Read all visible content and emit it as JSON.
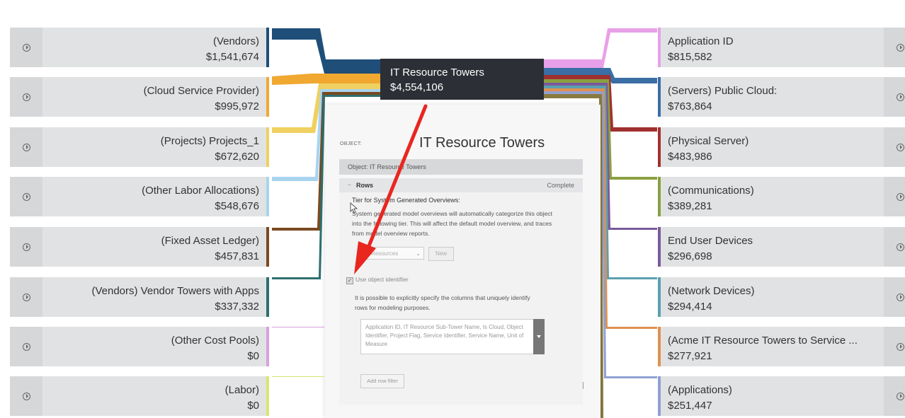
{
  "center": {
    "name": "IT Resource Towers",
    "value": "$4,554,106"
  },
  "left_nodes": [
    {
      "name": "(Vendors)",
      "value": "$1,541,674",
      "color": "#1f4e79"
    },
    {
      "name": "(Cloud Service Provider)",
      "value": "$995,972",
      "color": "#f0a830"
    },
    {
      "name": "(Projects) Projects_1",
      "value": "$672,620",
      "color": "#f0d060"
    },
    {
      "name": "(Other Labor Allocations)",
      "value": "$548,676",
      "color": "#a8d4f0"
    },
    {
      "name": "(Fixed Asset Ledger)",
      "value": "$457,831",
      "color": "#7a4a20"
    },
    {
      "name": "(Vendors) Vendor Towers with Apps",
      "value": "$337,332",
      "color": "#2e6f6f"
    },
    {
      "name": "(Other Cost Pools)",
      "value": "$0",
      "color": "#d8a0e0"
    },
    {
      "name": "(Labor)",
      "value": "$0",
      "color": "#d8e870"
    }
  ],
  "right_nodes": [
    {
      "name": "Application ID",
      "value": "$815,582",
      "color": "#e8a0e8"
    },
    {
      "name": "(Servers) Public Cloud:",
      "value": "$763,864",
      "color": "#3a6ea5"
    },
    {
      "name": "(Physical Server)",
      "value": "$483,986",
      "color": "#a03030"
    },
    {
      "name": "(Communications)",
      "value": "$389,281",
      "color": "#8aa040"
    },
    {
      "name": "End User Devices",
      "value": "$296,698",
      "color": "#7a5a9a"
    },
    {
      "name": "(Network Devices)",
      "value": "$294,414",
      "color": "#5aa0b0"
    },
    {
      "name": "(Acme IT Resource Towers to Service ...",
      "value": "$277,921",
      "color": "#e09050"
    },
    {
      "name": "(Applications)",
      "value": "$251,447",
      "color": "#90a0d0"
    }
  ],
  "panel": {
    "object_label": "OBJECT:",
    "title": "IT Resource Towers",
    "object_bar": "Object: IT Resource Towers",
    "rows_label": "Rows",
    "rows_status": "Complete",
    "tier_title": "Tier for System Generated Overviews:",
    "tier_desc": "System generated model overviews will automatically categorize this object into the following tier. This will affect the default model overview, and traces from model overview reports.",
    "tier_select": "Resources",
    "new_button": "New",
    "use_identifier": "Use object identifier",
    "use_identifier_desc": "It is possible to explicitly specify the columns that uniquely identify rows for modeling purposes.",
    "identifier_columns": "Application ID, IT Resource Sub-Tower Name, Is Cloud, Object Identifier, Project Flag, Service Identifier, Service Name, Unit of Measure",
    "add_row_filter": "Add row filter"
  }
}
